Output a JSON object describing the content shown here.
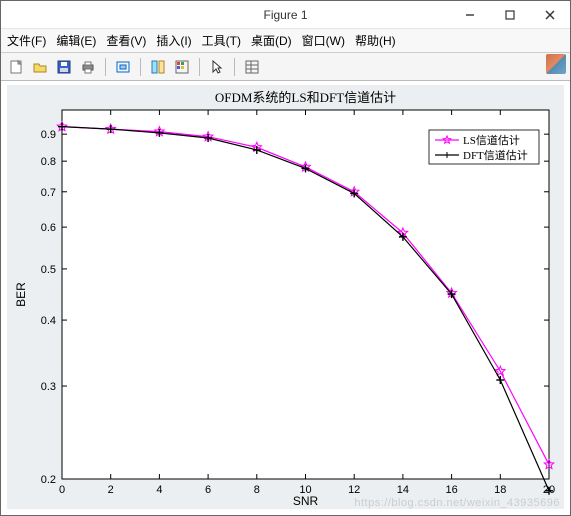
{
  "window": {
    "title": "Figure 1"
  },
  "menu": {
    "file": "文件(F)",
    "edit": "编辑(E)",
    "view": "查看(V)",
    "insert": "插入(I)",
    "tools": "工具(T)",
    "desktop": "桌面(D)",
    "window": "窗口(W)",
    "help": "帮助(H)"
  },
  "legend": {
    "ls": "LS信道估计",
    "dft": "DFT信道估计"
  },
  "watermark": "https://blog.csdn.net/weixin_43935696",
  "chart_data": {
    "type": "line",
    "title": "OFDM系统的LS和DFT信道估计",
    "xlabel": "SNR",
    "ylabel": "BER",
    "xlim": [
      0,
      20
    ],
    "ylim": [
      0.2,
      1.0
    ],
    "grid": false,
    "legend_position": "top-right",
    "x": [
      0,
      2,
      4,
      6,
      8,
      10,
      12,
      14,
      16,
      18,
      20
    ],
    "xticks": [
      0,
      2,
      4,
      6,
      8,
      10,
      12,
      14,
      16,
      18,
      20
    ],
    "yticks": [
      0.2,
      0.3,
      0.4,
      0.5,
      0.6,
      0.7,
      0.8,
      0.9
    ],
    "yscale": "log",
    "series": [
      {
        "name": "LS信道估计",
        "marker": "star",
        "color": "#ff00ff",
        "values": [
          0.93,
          0.92,
          0.91,
          0.89,
          0.85,
          0.78,
          0.7,
          0.585,
          0.45,
          0.32,
          0.213
        ]
      },
      {
        "name": "DFT信道估计",
        "marker": "plus",
        "color": "#000000",
        "values": [
          0.93,
          0.92,
          0.905,
          0.885,
          0.84,
          0.775,
          0.695,
          0.575,
          0.448,
          0.308,
          0.19
        ]
      }
    ]
  }
}
